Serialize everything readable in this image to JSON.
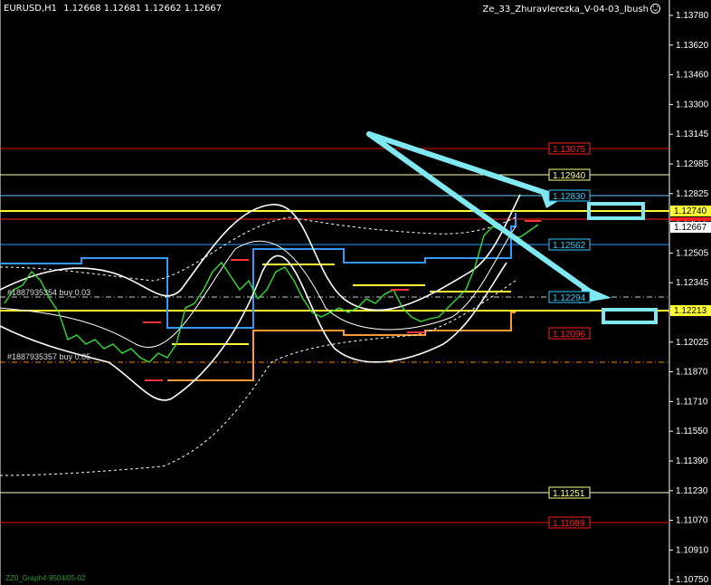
{
  "header": {
    "symbol": "EURUSD,H1",
    "ohlc": "1.12668 1.12681 1.12662 1.12667",
    "indicator": "Ze_33_Zhuravlerezka_V-04-03_Ibush"
  },
  "price_axis": {
    "ticks": [
      "1.13780",
      "1.13620",
      "1.13460",
      "1.13300",
      "1.13145",
      "1.12985",
      "1.12825",
      "1.12665",
      "1.12505",
      "1.12345",
      "1.12185",
      "1.12025",
      "1.11870",
      "1.11710",
      "1.11550",
      "1.11390",
      "1.11230",
      "1.11070",
      "1.10910",
      "1.10750"
    ],
    "current_price": "1.12667",
    "highlight_yellow": "1.12740",
    "highlight_white": "1.12213"
  },
  "levels": [
    {
      "value": "1.13075",
      "color": "#ff2020"
    },
    {
      "value": "1.12940",
      "color": "#ffff80"
    },
    {
      "value": "1.12830",
      "color": "#33ccff"
    },
    {
      "value": "1.12562",
      "color": "#33ccff"
    },
    {
      "value": "1.12294",
      "color": "#33ccff"
    },
    {
      "value": "1.12096",
      "color": "#ff2020"
    },
    {
      "value": "1.11251",
      "color": "#ffff80"
    },
    {
      "value": "1.11089",
      "color": "#ff2020"
    }
  ],
  "orders": [
    {
      "text": "#1887935354 buy 0.03"
    },
    {
      "text": "#1887935357 buy 0.05"
    }
  ],
  "footer": "ZZ0_Graph4-9504/05-02",
  "colors": {
    "background": "#000000",
    "candle": "#00ff00",
    "band": "#ffffff",
    "channel": "#3399ff",
    "support": "#ff9933",
    "arrow": "#7fe8f0",
    "level_yellow": "#ffff33"
  }
}
